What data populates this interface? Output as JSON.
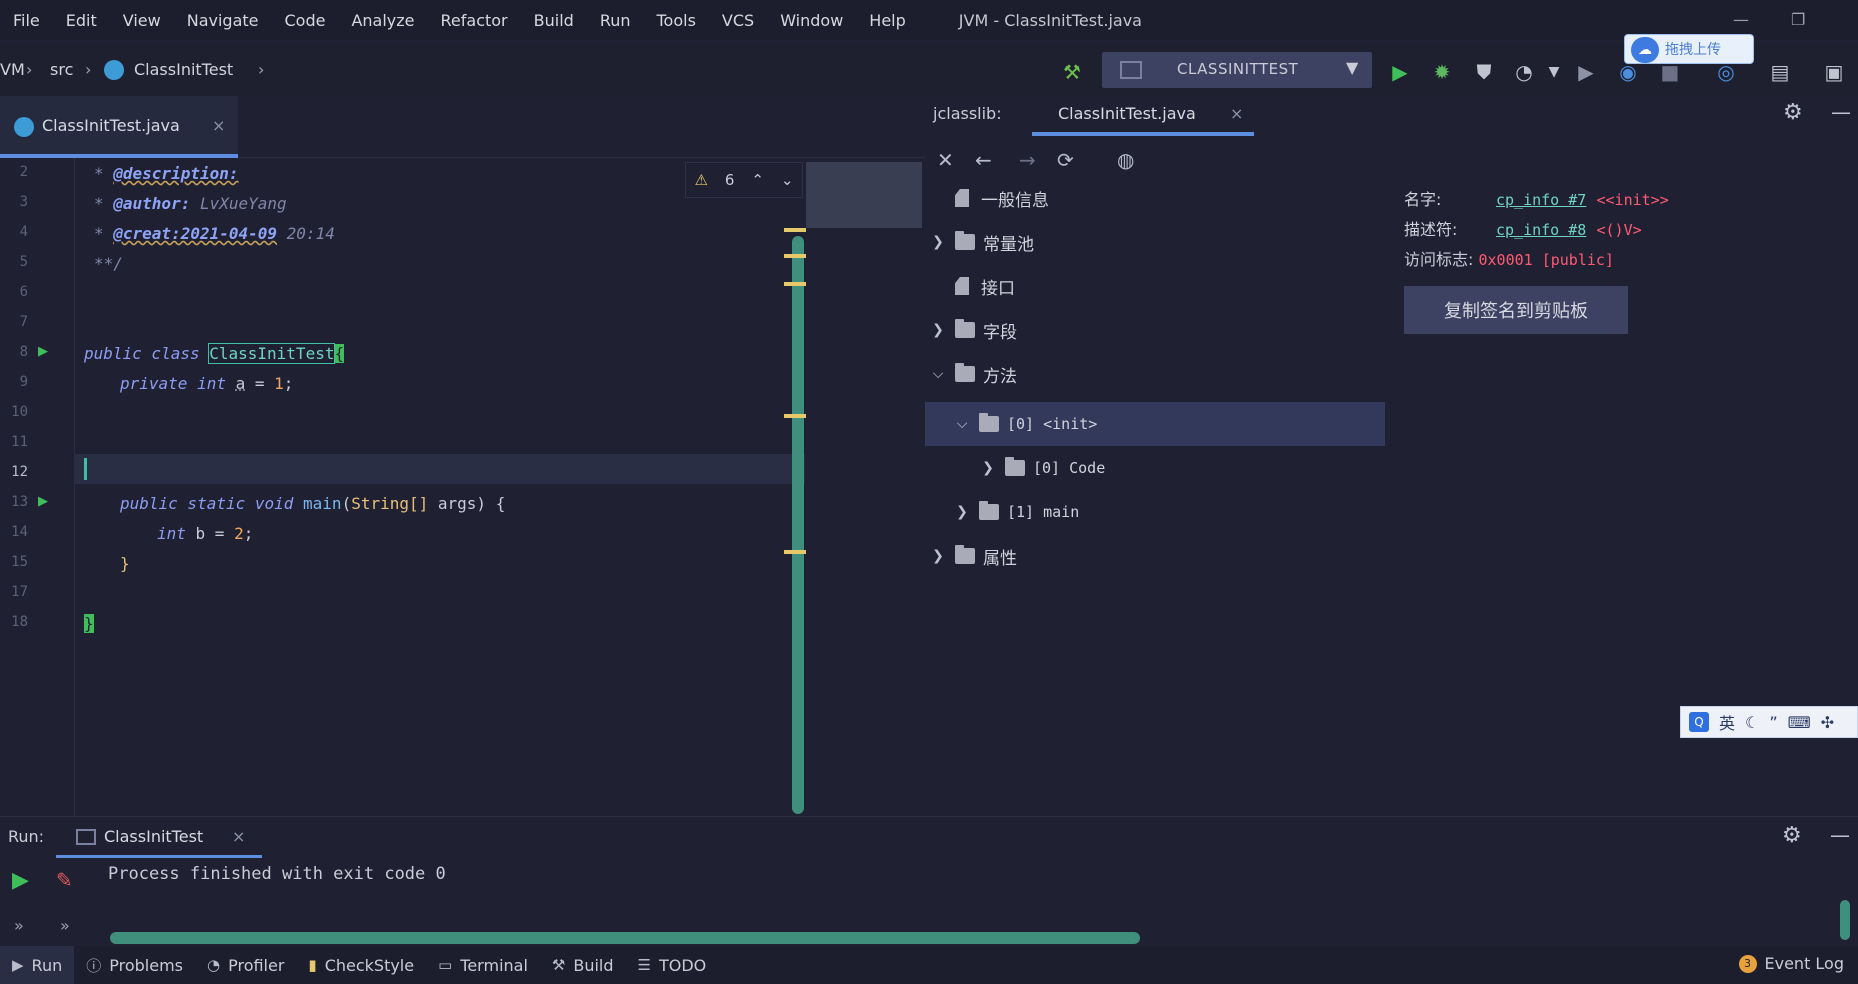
{
  "menu": [
    "File",
    "Edit",
    "View",
    "Navigate",
    "Code",
    "Analyze",
    "Refactor",
    "Build",
    "Run",
    "Tools",
    "VCS",
    "Window",
    "Help"
  ],
  "window_title": "JVM - ClassInitTest.java",
  "breadcrumb": {
    "root": "VM",
    "src": "src",
    "file": "ClassInitTest"
  },
  "run_config": "CLASSINITTEST",
  "editor_tab": "ClassInitTest.java",
  "inspection_count": "6",
  "code": {
    "l2_tag": "@description:",
    "l3_tag": "@author:",
    "l3_val": " LvXueYang",
    "l4_tag": "@creat:2021-04-09",
    "l4_val": " 20:14",
    "l5": "**/",
    "l8_kw": "public class ",
    "l8_cls": "ClassInitTest",
    "l8_br": "{",
    "l9_kw": "private int ",
    "l9_var": "a",
    "l9_eq": " = ",
    "l9_num": "1",
    "l9_end": ";",
    "l13_kw": "public static void ",
    "l13_fn": "main",
    "l13_p1": "(",
    "l13_type": "String[]",
    "l13_p2": " args) {",
    "l14_kw": "int ",
    "l14_var": "b",
    "l14_eq": " = ",
    "l14_num": "2",
    "l14_end": ";",
    "l15": "}",
    "l17": "}"
  },
  "line_numbers": [
    "2",
    "3",
    "4",
    "5",
    "6",
    "7",
    "8",
    "9",
    "10",
    "11",
    "12",
    "13",
    "14",
    "15",
    "17",
    "18"
  ],
  "jclasslib": {
    "label": "jclasslib:",
    "tab": "ClassInitTest.java",
    "tree": {
      "general": "一般信息",
      "constant_pool": "常量池",
      "interfaces": "接口",
      "fields": "字段",
      "methods": "方法",
      "init": "[0] <init>",
      "code": "[0] Code",
      "main": "[1] main",
      "attributes": "属性"
    },
    "details": {
      "name_label": "名字:",
      "name_link": "cp_info #7",
      "name_val": "<<init>>",
      "desc_label": "描述符:",
      "desc_link": "cp_info #8",
      "desc_val": "<()V>",
      "access_label": "访问标志:",
      "access_val": "0x0001 [public]",
      "copy_button": "复制签名到剪贴板"
    }
  },
  "upload_button": "拖拽上传",
  "ime": {
    "lang": "英"
  },
  "run_panel": {
    "label": "Run:",
    "tab": "ClassInitTest",
    "output": "Process finished with exit code 0"
  },
  "bottom_tools": [
    "Run",
    "Problems",
    "Profiler",
    "CheckStyle",
    "Terminal",
    "Build",
    "TODO"
  ],
  "event_log": {
    "label": "Event Log",
    "count": "3"
  }
}
